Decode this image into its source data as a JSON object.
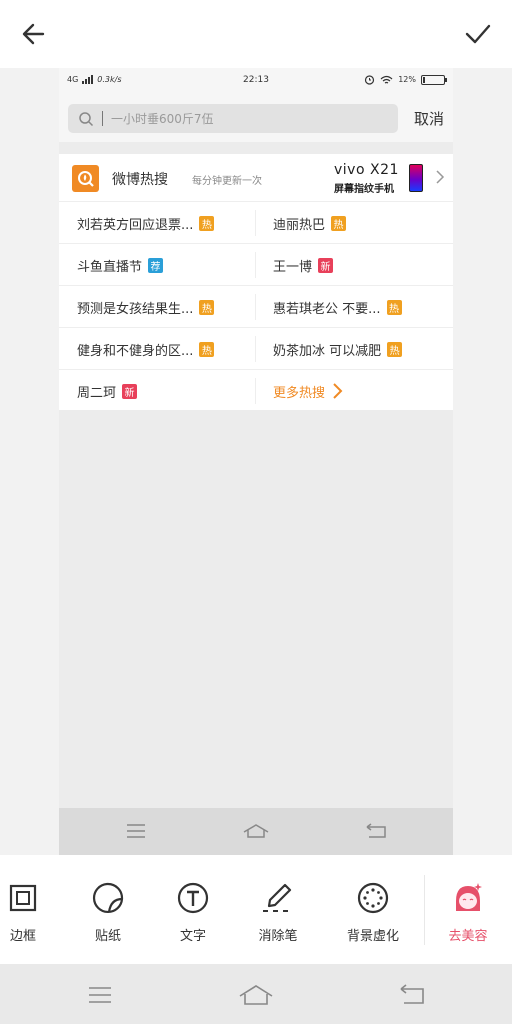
{
  "editor": {
    "back_icon": "arrow-left-icon",
    "confirm_icon": "checkmark-icon"
  },
  "screenshot": {
    "status_bar": {
      "network": "4G",
      "speed": "0.3k/s",
      "time": "22:13",
      "battery": "12%",
      "battery_level": 0.12
    },
    "search": {
      "placeholder": "一小时垂600斤7伍",
      "cancel_label": "取消"
    },
    "hot": {
      "title": "微博热搜",
      "subtitle": "每分钟更新一次",
      "ad_brand": "vivo X21",
      "ad_slogan": "屏幕指纹手机",
      "rows": [
        {
          "left": {
            "text": "刘若英方回应退票...",
            "badge": "热",
            "badge_color": "#f0a020"
          },
          "right": {
            "text": "迪丽热巴",
            "badge": "热",
            "badge_color": "#f0a020"
          }
        },
        {
          "left": {
            "text": "斗鱼直播节",
            "badge": "荐",
            "badge_color": "#2a9fd8"
          },
          "right": {
            "text": "王一博",
            "badge": "新",
            "badge_color": "#e8405a"
          }
        },
        {
          "left": {
            "text": "预测是女孩结果生...",
            "badge": "热",
            "badge_color": "#f0a020"
          },
          "right": {
            "text": "惠若琪老公 不要...",
            "badge": "热",
            "badge_color": "#f0a020"
          }
        },
        {
          "left": {
            "text": "健身和不健身的区...",
            "badge": "热",
            "badge_color": "#f0a020"
          },
          "right": {
            "text": "奶茶加冰 可以减肥",
            "badge": "热",
            "badge_color": "#f0a020"
          }
        },
        {
          "left": {
            "text": "周二珂",
            "badge": "新",
            "badge_color": "#e8405a"
          },
          "right": {
            "text": "更多热搜",
            "badge": "",
            "badge_color": ""
          }
        }
      ]
    }
  },
  "tools": [
    {
      "label": "边框",
      "icon": "frame-icon"
    },
    {
      "label": "贴纸",
      "icon": "sticker-icon"
    },
    {
      "label": "文字",
      "icon": "text-icon"
    },
    {
      "label": "消除笔",
      "icon": "eraser-pen-icon"
    },
    {
      "label": "背景虚化",
      "icon": "background-blur-icon"
    },
    {
      "label": "去美容",
      "icon": "beauty-face-icon"
    }
  ],
  "colors": {
    "accent_orange": "#f08a24",
    "beauty_pink": "#e6506a"
  }
}
